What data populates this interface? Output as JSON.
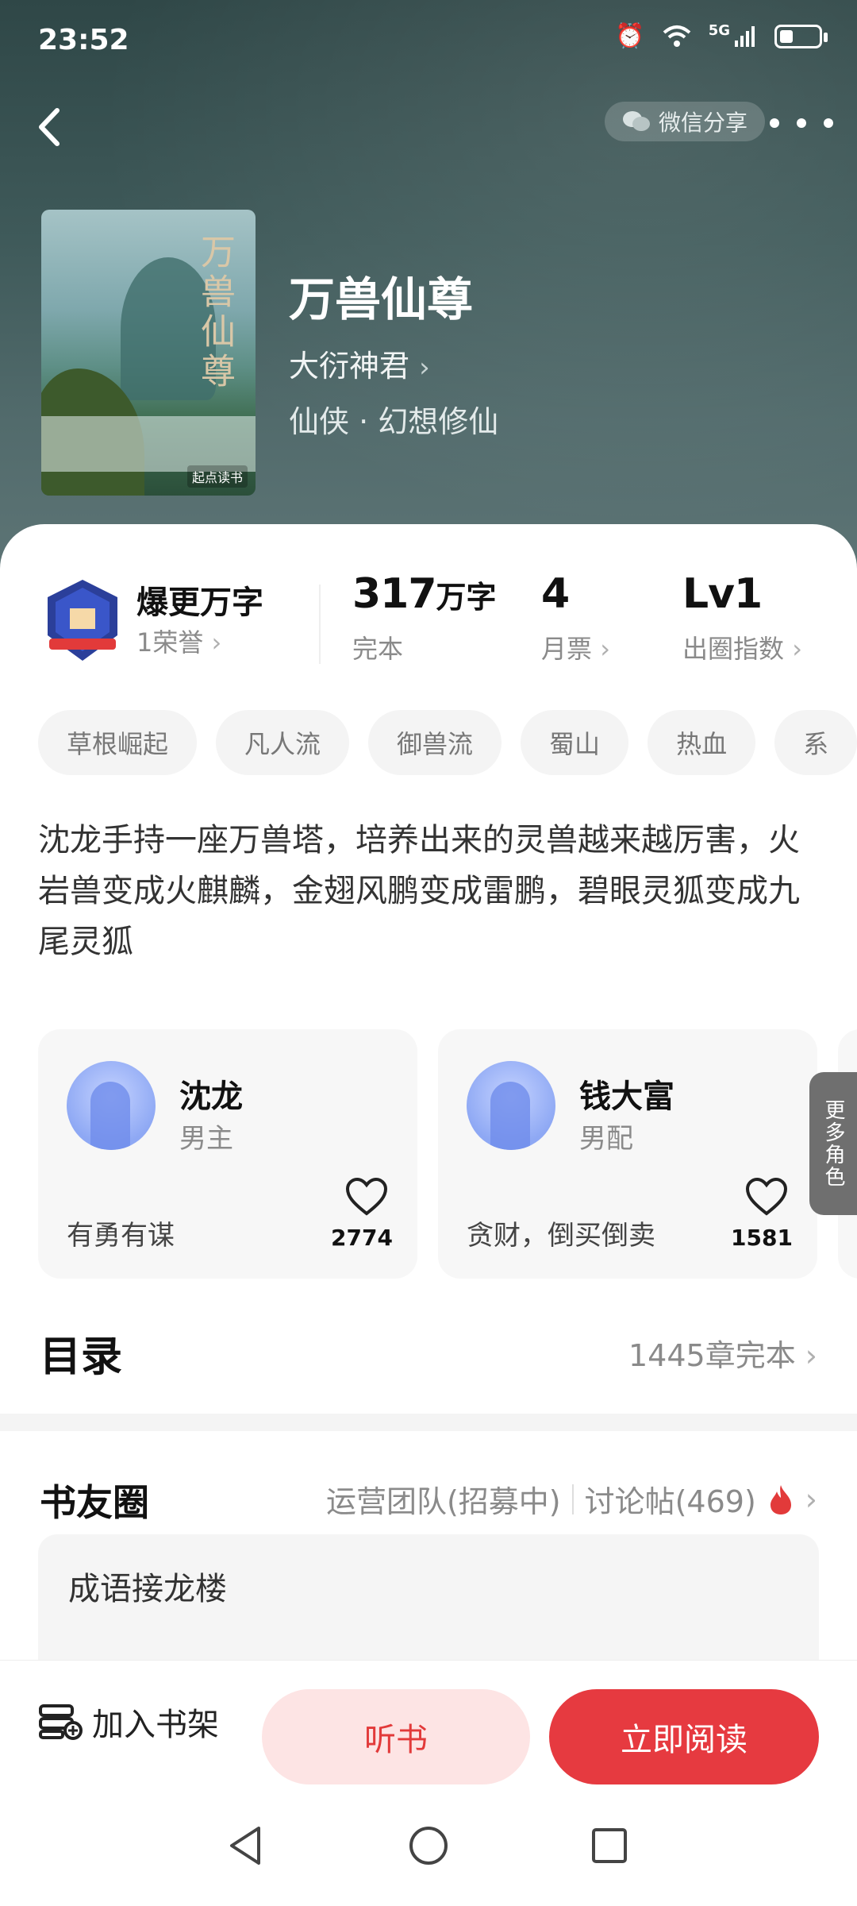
{
  "status_bar": {
    "time": "23:52",
    "network": "5G"
  },
  "nav": {
    "share_label": "微信分享"
  },
  "book": {
    "title": "万兽仙尊",
    "author": "大衍神君",
    "genre": "仙侠 · 幻想修仙",
    "cover_title": "万兽仙尊",
    "cover_publisher": "起点读书"
  },
  "stats": {
    "honor_title": "爆更万字",
    "honor_sub": "1荣誉",
    "word_count": "317",
    "word_unit": "万字",
    "status": "完本",
    "monthly_votes": "4",
    "monthly_label": "月票",
    "level": "Lv1",
    "level_label": "出圈指数"
  },
  "tags": [
    "草根崛起",
    "凡人流",
    "御兽流",
    "蜀山",
    "热血",
    "系"
  ],
  "description": "沈龙手持一座万兽塔，培养出来的灵兽越来越厉害，火岩兽变成火麒麟，金翅风鹏变成雷鹏，碧眼灵狐变成九尾灵狐",
  "characters": [
    {
      "name": "沈龙",
      "role": "男主",
      "trait": "有勇有谋",
      "likes": "2774"
    },
    {
      "name": "钱大富",
      "role": "男配",
      "trait": "贪财，倒买倒卖",
      "likes": "1581"
    }
  ],
  "more_roles_label": "更多角色",
  "toc": {
    "title": "目录",
    "count": "1445章完本"
  },
  "circle": {
    "title": "书友圈",
    "team": "运营团队(招募中)",
    "posts": "讨论帖(469)",
    "first_post": "成语接龙楼"
  },
  "bottom": {
    "shelf_label": "加入书架",
    "listen_label": "听书",
    "read_label": "立即阅读"
  },
  "colors": {
    "accent": "#e63a40",
    "listen_bg": "#fde4e4",
    "hero_bg": "#3f5a5a"
  }
}
